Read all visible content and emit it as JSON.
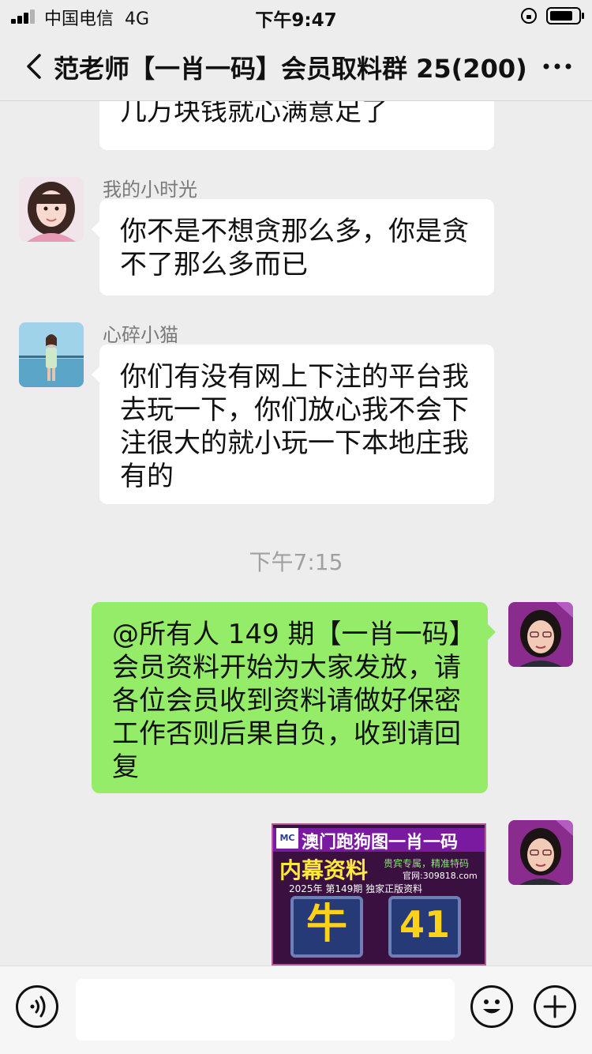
{
  "status_bar": {
    "carrier": "中国电信",
    "network": "4G",
    "time": "下午9:47"
  },
  "nav": {
    "title": "范老师【一肖一码】会员取料群 25(200)"
  },
  "messages": [
    {
      "text": "几万块钱就心满意足了"
    },
    {
      "sender": "我的小时光",
      "text_lines": [
        "你不是不想贪那么多，你是贪",
        "不了那么多而已"
      ]
    },
    {
      "sender": "心碎小猫",
      "text_lines": [
        "你们有没有网上下注的平台我",
        "去玩一下，你们放心我不会下",
        "注很大的就小玩一下本地庄我",
        "有的"
      ]
    }
  ],
  "timestamp": "下午7:15",
  "own_message": {
    "text_lines": [
      "@所有人 149 期【一肖一码】",
      "会员资料开始为大家发放，请",
      "各位会员收到资料请做好保密",
      "工作否则后果自负，收到请回",
      "复"
    ]
  },
  "image_message": {
    "title": "澳门跑狗图一肖一码",
    "subtitle": "内幕资料",
    "slogan": "贵宾专属，精准特码",
    "website": "官网:309818.com",
    "issue": "2025年 第149期 独家正版资料",
    "zodiac": "牛",
    "number": "41",
    "logo": "MC"
  },
  "colors": {
    "background": "#ededed",
    "own_bubble": "#95ec69",
    "other_bubble": "#ffffff"
  }
}
